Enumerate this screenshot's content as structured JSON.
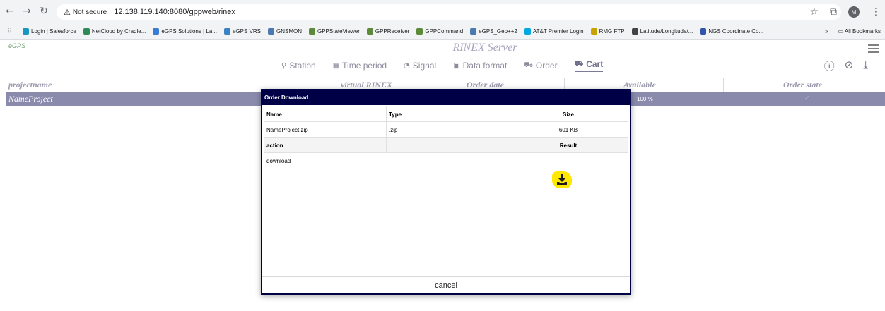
{
  "browser": {
    "security_label": "Not secure",
    "url": "12.138.119.140:8080/gppweb/rinex",
    "profile_initial": "M",
    "bookmarks": [
      {
        "label": "Login | Salesforce",
        "color": "#1798c1"
      },
      {
        "label": "NetCloud by Cradle...",
        "color": "#2e8b57"
      },
      {
        "label": "eGPS Solutions | La...",
        "color": "#3a7bd5"
      },
      {
        "label": "eGPS VRS",
        "color": "#3b82c4"
      },
      {
        "label": "GNSMON",
        "color": "#4a7ab0"
      },
      {
        "label": "GPPStateViewer",
        "color": "#5a8a3a"
      },
      {
        "label": "GPPReceiver",
        "color": "#5a8a3a"
      },
      {
        "label": "GPPCommand",
        "color": "#5a8a3a"
      },
      {
        "label": "eGPS_Geo++2",
        "color": "#4a7ab0"
      },
      {
        "label": "AT&T Premier Login",
        "color": "#00a8e0"
      },
      {
        "label": "RMG FTP",
        "color": "#c8a200"
      },
      {
        "label": "Latitude/Longitude/...",
        "color": "#444444"
      },
      {
        "label": "NGS Coordinate Co...",
        "color": "#3355aa"
      }
    ],
    "more_bookmarks": "»",
    "all_bookmarks": "All Bookmarks"
  },
  "app": {
    "logo": "eGPS",
    "title": "RINEX Server",
    "menu": [
      {
        "label": "Station",
        "icon": "map-marker-icon",
        "glyph": "⚲"
      },
      {
        "label": "Time period",
        "icon": "calendar-icon",
        "glyph": "▦"
      },
      {
        "label": "Signal",
        "icon": "rss-icon",
        "glyph": "◔"
      },
      {
        "label": "Data format",
        "icon": "save-icon",
        "glyph": "▣"
      },
      {
        "label": "Order",
        "icon": "cart-icon",
        "glyph": "⛟"
      },
      {
        "label": "Cart",
        "icon": "cart-icon",
        "glyph": "⛟"
      }
    ]
  },
  "grid": {
    "headers": [
      "projectname",
      "virtual RINEX",
      "Order date",
      "Available",
      "Order state"
    ],
    "row": {
      "projectname": "NameProject",
      "available": "100 %",
      "state": "✓"
    }
  },
  "modal": {
    "title": "Order Download",
    "header": {
      "name": "Name",
      "type": "Type",
      "size": "Size"
    },
    "file": {
      "name": "NameProject.zip",
      "type": ".zip",
      "size": "601 KB"
    },
    "action_header": {
      "action": "action",
      "result": "Result"
    },
    "action_row": {
      "action": "download"
    },
    "cancel": "cancel",
    "highlight_color": "#ffe800"
  }
}
